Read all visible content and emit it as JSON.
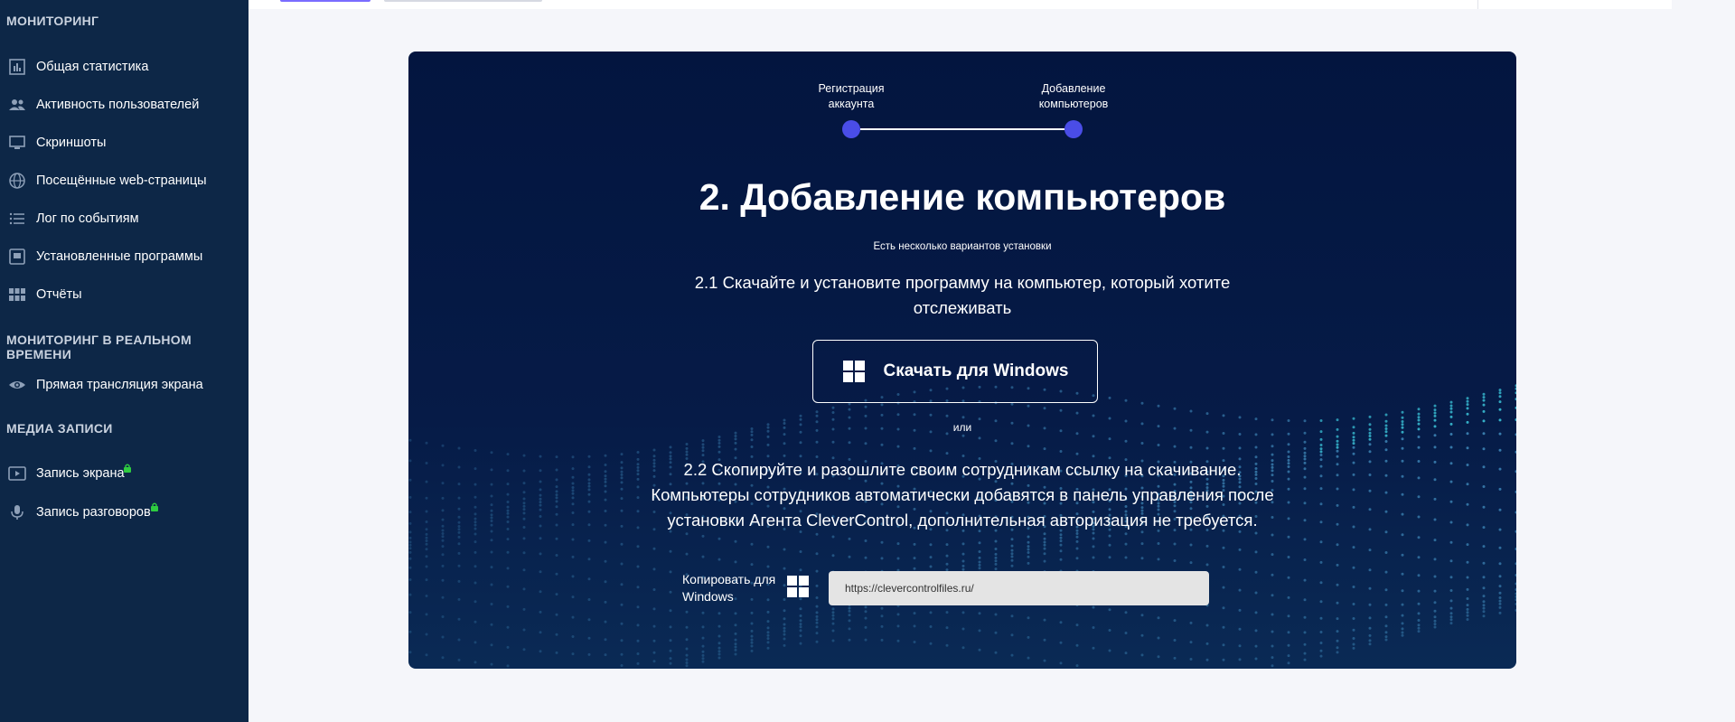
{
  "sidebar": {
    "section_monitoring": "МОНИТОРИНГ",
    "items": [
      {
        "label": "Общая статистика",
        "icon": "bar-chart-icon"
      },
      {
        "label": "Активность пользователей",
        "icon": "users-icon"
      },
      {
        "label": "Скриншоты",
        "icon": "monitor-icon"
      },
      {
        "label": "Посещённые web-страницы",
        "icon": "globe-icon"
      },
      {
        "label": "Лог по событиям",
        "icon": "list-icon"
      },
      {
        "label": "Установленные программы",
        "icon": "app-install-icon"
      },
      {
        "label": "Отчёты",
        "icon": "grid-icon"
      }
    ],
    "section_realtime": "МОНИТОРИНГ В РЕАЛЬНОМ ВРЕМЕНИ",
    "realtime_items": [
      {
        "label": "Прямая трансляция экрана",
        "icon": "eye-icon"
      }
    ],
    "section_media": "МЕДИА ЗАПИСИ",
    "media_items": [
      {
        "label": "Запись экрана",
        "icon": "video-icon",
        "locked": true
      },
      {
        "label": "Запись разговоров",
        "icon": "microphone-icon",
        "locked": true
      }
    ]
  },
  "stepper": {
    "step1_label": "Регистрация аккаунта",
    "step2_label": "Добавление компьютеров"
  },
  "content": {
    "title": "2. Добавление компьютеров",
    "subtitle": "Есть несколько вариантов установки",
    "option1": "2.1 Скачайте и установите программу на компьютер, который хотите отслеживать",
    "download_button": "Скачать для Windows",
    "or_text": "или",
    "option2": "2.2 Скопируйте и разошлите своим сотрудникам ссылку на скачивание. Компьютеры сотрудников автоматически добавятся в панель управления после установки Агента CleverControl, дополнительная авторизация не требуется.",
    "copy_label": "Копировать для Windows",
    "download_link": "https://clevercontrolfiles.ru/"
  },
  "colors": {
    "sidebar_bg": "#0d2747",
    "card_bg": "#03153f",
    "step_dot": "#4a4de7",
    "lock_green": "#2ecc40"
  }
}
